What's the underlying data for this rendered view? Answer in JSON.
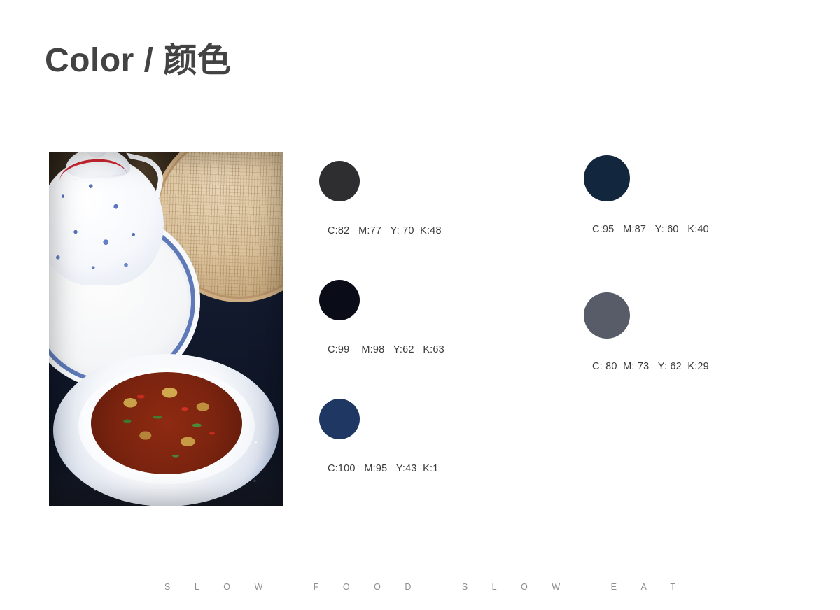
{
  "page": {
    "title": "Color / 颜色",
    "background_color": "#ffffff",
    "title_color": "#434343"
  },
  "photo": {
    "caption": "Blue-and-white porcelain teapot on a plate, bamboo steamer lid, and a bowl of spicy stir-fried lotus root on indigo batik cloth",
    "alt_name": "slow-food-dish-photo"
  },
  "palette": {
    "left_column": [
      {
        "swatch_name": "charcoal",
        "hex": "#2e2e30",
        "label": "C:82   M:77   Y: 70  K:48"
      },
      {
        "swatch_name": "near-black-navy",
        "hex": "#0a0c18",
        "label": "C:99    M:98   Y:62   K:63"
      },
      {
        "swatch_name": "navy-blue",
        "hex": "#1f3763",
        "label": "C:100   M:95   Y:43  K:1"
      }
    ],
    "right_column": [
      {
        "swatch_name": "dark-navy",
        "hex": "#12263d",
        "label": "C:95   M:87   Y: 60   K:40"
      },
      {
        "swatch_name": "slate-gray",
        "hex": "#585c68",
        "label": "C: 80  M: 73   Y: 62  K:29"
      }
    ]
  },
  "footer": {
    "text": "SLOW FOOD SLOW EAT",
    "color": "#8e8e8e"
  }
}
